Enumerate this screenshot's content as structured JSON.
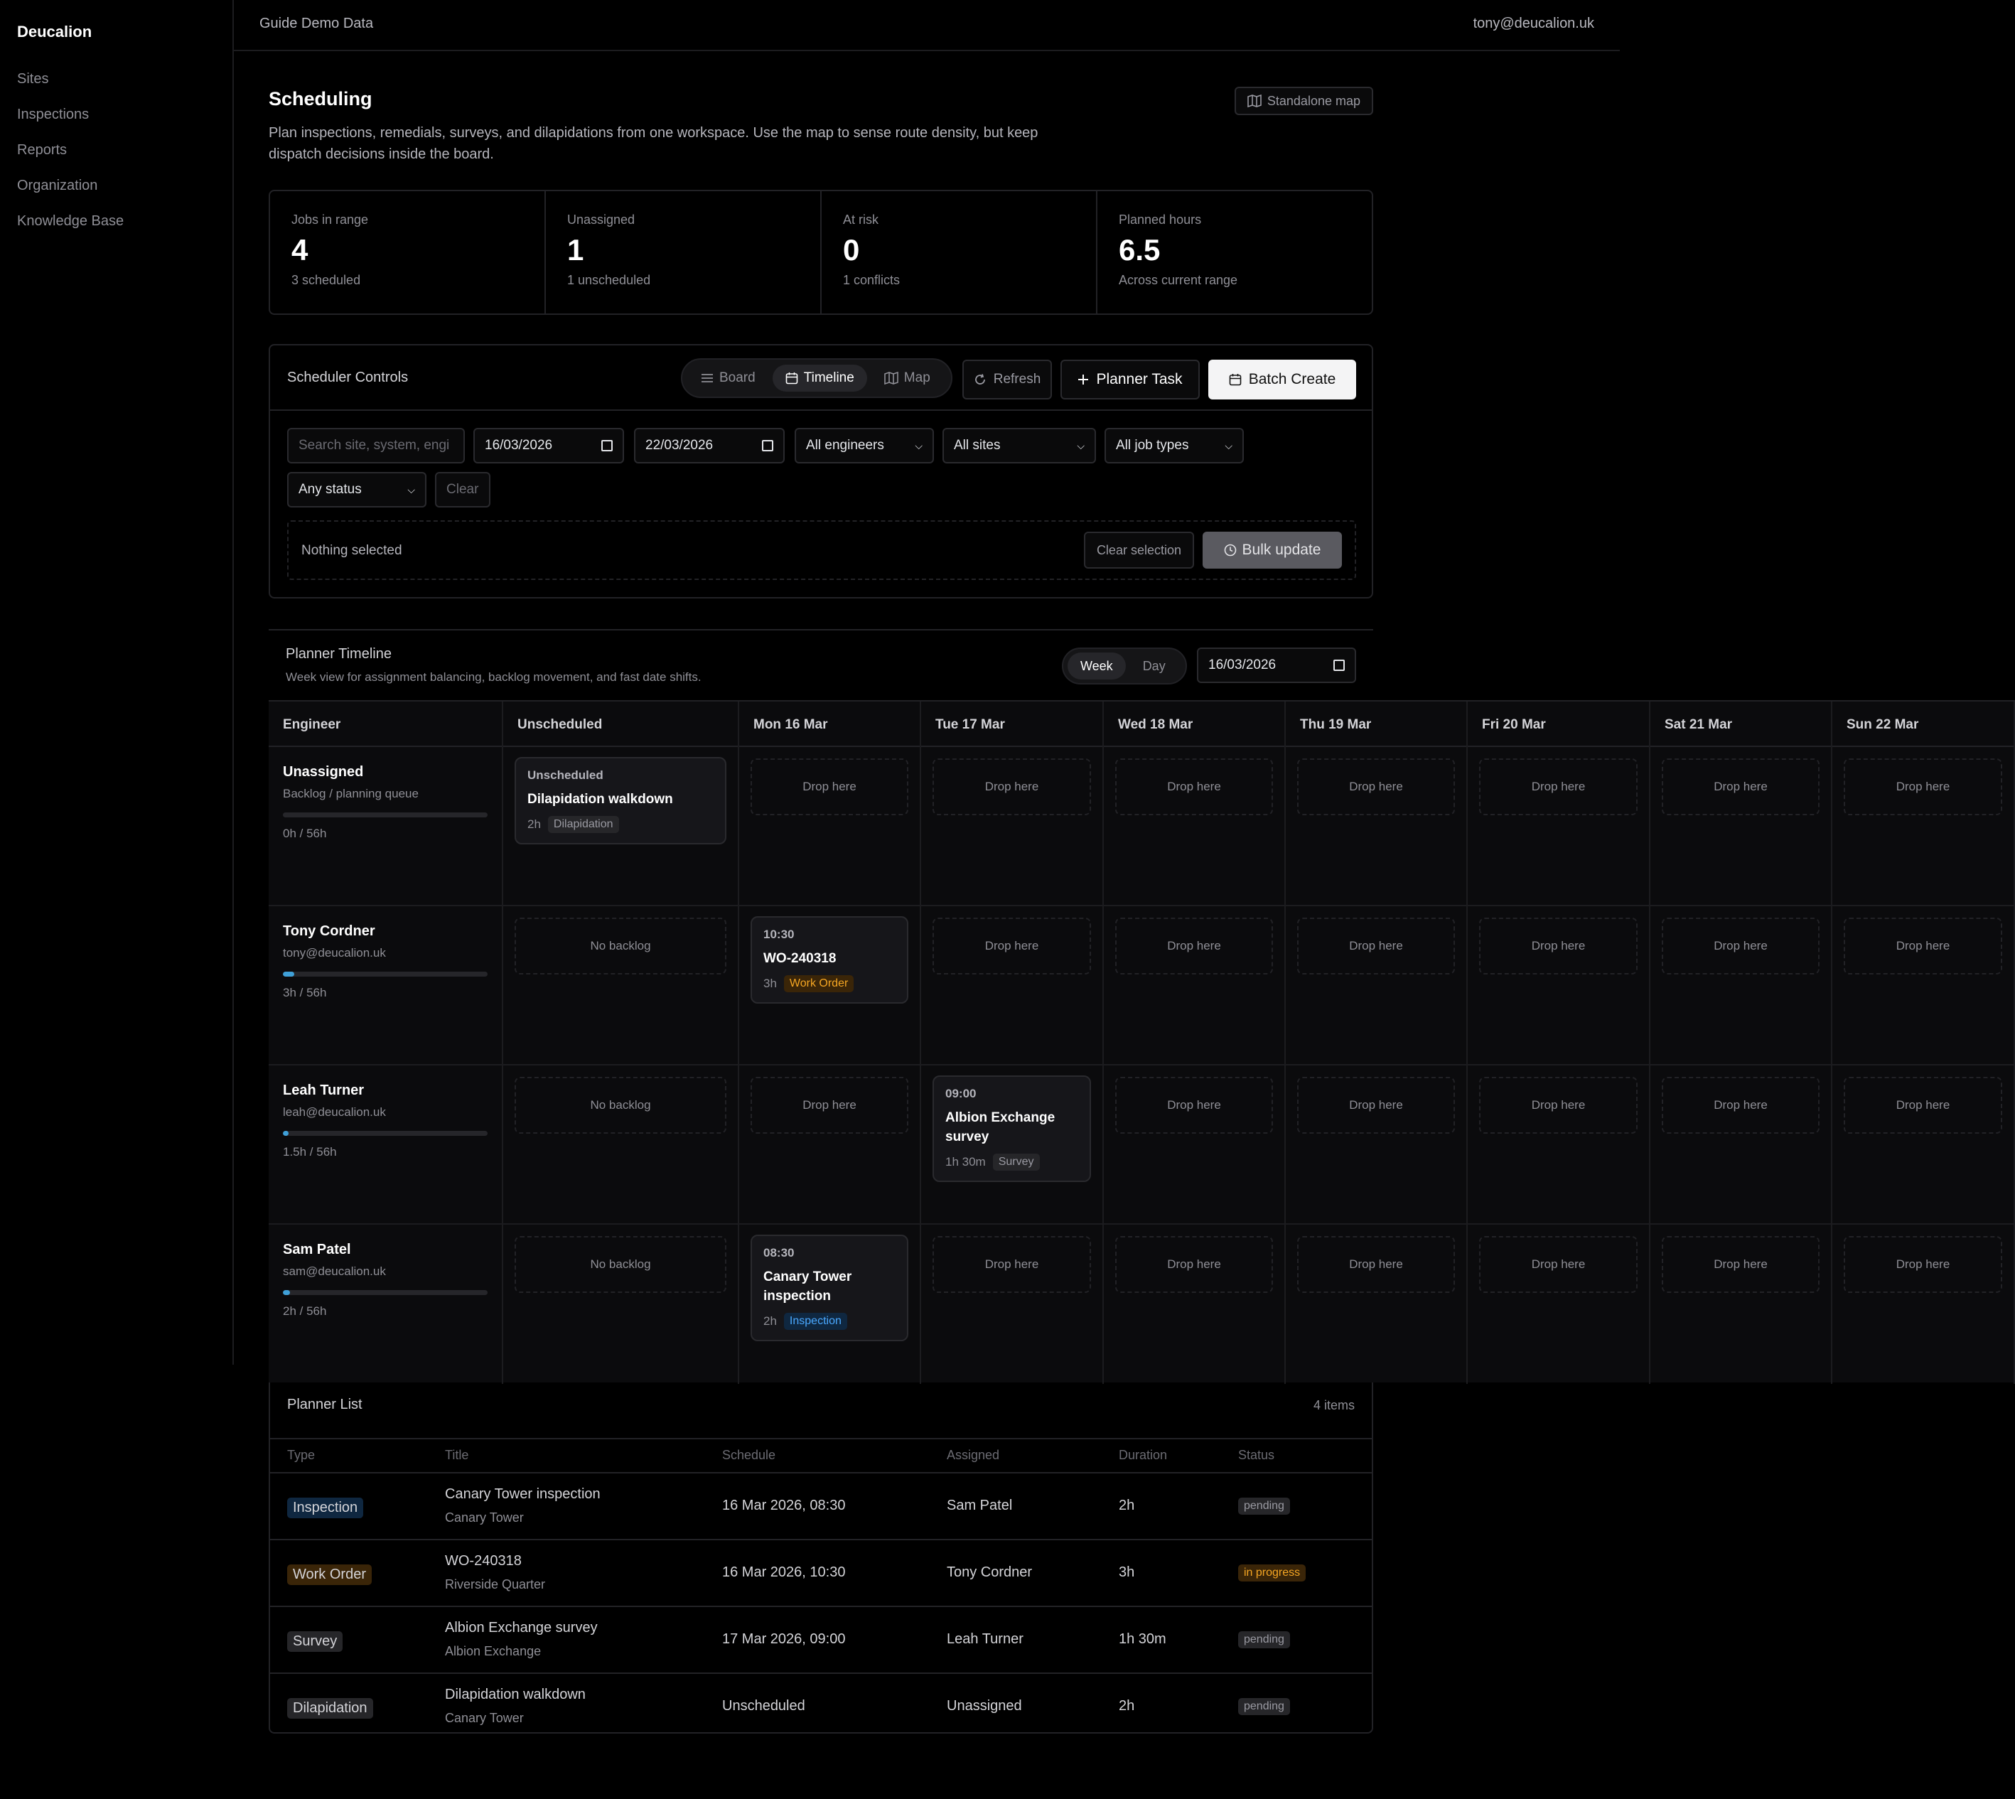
{
  "sidebar": {
    "brand": "Deucalion",
    "items": [
      "Sites",
      "Inspections",
      "Reports",
      "Organization",
      "Knowledge Base"
    ]
  },
  "topbar": {
    "tenant": "Guide Demo Data",
    "user": "tony@deucalion.uk"
  },
  "page": {
    "title": "Scheduling",
    "description": "Plan inspections, remedials, surveys, and dilapidations from one workspace. Use the map to sense route density, but keep dispatch decisions inside the board.",
    "standalone_map": "Standalone map"
  },
  "stats": [
    {
      "label": "Jobs in range",
      "value": "4",
      "sub": "3 scheduled"
    },
    {
      "label": "Unassigned",
      "value": "1",
      "sub": "1 unscheduled"
    },
    {
      "label": "At risk",
      "value": "0",
      "sub": "1 conflicts"
    },
    {
      "label": "Planned hours",
      "value": "6.5",
      "sub": "Across current range"
    }
  ],
  "controls": {
    "title": "Scheduler Controls",
    "views": [
      "Board",
      "Timeline",
      "Map"
    ],
    "active_view": "Timeline",
    "refresh": "Refresh",
    "planner_task": "Planner Task",
    "batch_create": "Batch Create",
    "search_placeholder": "Search site, system, engi",
    "date_from": "16/03/2026",
    "date_to": "22/03/2026",
    "engineers": "All engineers",
    "sites": "All sites",
    "job_types": "All job types",
    "status": "Any status",
    "clear": "Clear",
    "selection_text": "Nothing selected",
    "clear_selection": "Clear selection",
    "bulk_update": "Bulk update"
  },
  "timeline": {
    "title": "Planner Timeline",
    "subtitle": "Week view for assignment balancing, backlog movement, and fast date shifts.",
    "modes": [
      "Week",
      "Day"
    ],
    "active_mode": "Week",
    "date": "16/03/2026",
    "columns": [
      "Engineer",
      "Unscheduled",
      "Mon 16 Mar",
      "Tue 17 Mar",
      "Wed 18 Mar",
      "Thu 19 Mar",
      "Fri 20 Mar",
      "Sat 21 Mar",
      "Sun 22 Mar"
    ],
    "drop_label": "Drop here",
    "no_backlog": "No backlog",
    "rows": [
      {
        "name": "Unassigned",
        "email": "Backlog / planning queue",
        "hours": "0h / 56h",
        "load": 0
      },
      {
        "name": "Tony Cordner",
        "email": "tony@deucalion.uk",
        "hours": "3h / 56h",
        "load": 0.054
      },
      {
        "name": "Leah Turner",
        "email": "leah@deucalion.uk",
        "hours": "1.5h / 56h",
        "load": 0.027
      },
      {
        "name": "Sam Patel",
        "email": "sam@deucalion.uk",
        "hours": "2h / 56h",
        "load": 0.036
      }
    ],
    "cards": {
      "backlog": {
        "time": "Unscheduled",
        "title": "Dilapidation walkdown",
        "duration": "2h",
        "type": "Dilapidation"
      },
      "tony": {
        "time": "10:30",
        "title": "WO-240318",
        "duration": "3h",
        "type": "Work Order"
      },
      "leah": {
        "time": "09:00",
        "title": "Albion Exchange survey",
        "duration": "1h 30m",
        "type": "Survey"
      },
      "sam": {
        "time": "08:30",
        "title": "Canary Tower inspection",
        "duration": "2h",
        "type": "Inspection"
      }
    }
  },
  "planner_list": {
    "title": "Planner List",
    "count": "4 items",
    "headers": [
      "Type",
      "Title",
      "Schedule",
      "Assigned",
      "Duration",
      "Status"
    ],
    "rows": [
      {
        "type": "Inspection",
        "title": "Canary Tower inspection",
        "site": "Canary Tower",
        "schedule": "16 Mar 2026, 08:30",
        "assigned": "Sam Patel",
        "duration": "2h",
        "status": "pending"
      },
      {
        "type": "Work Order",
        "title": "WO-240318",
        "site": "Riverside Quarter",
        "schedule": "16 Mar 2026, 10:30",
        "assigned": "Tony Cordner",
        "duration": "3h",
        "status": "in progress"
      },
      {
        "type": "Survey",
        "title": "Albion Exchange survey",
        "site": "Albion Exchange",
        "schedule": "17 Mar 2026, 09:00",
        "assigned": "Leah Turner",
        "duration": "1h 30m",
        "status": "pending"
      },
      {
        "type": "Dilapidation",
        "title": "Dilapidation walkdown",
        "site": "Canary Tower",
        "schedule": "Unscheduled",
        "assigned": "Unassigned",
        "duration": "2h",
        "status": "pending"
      }
    ]
  }
}
